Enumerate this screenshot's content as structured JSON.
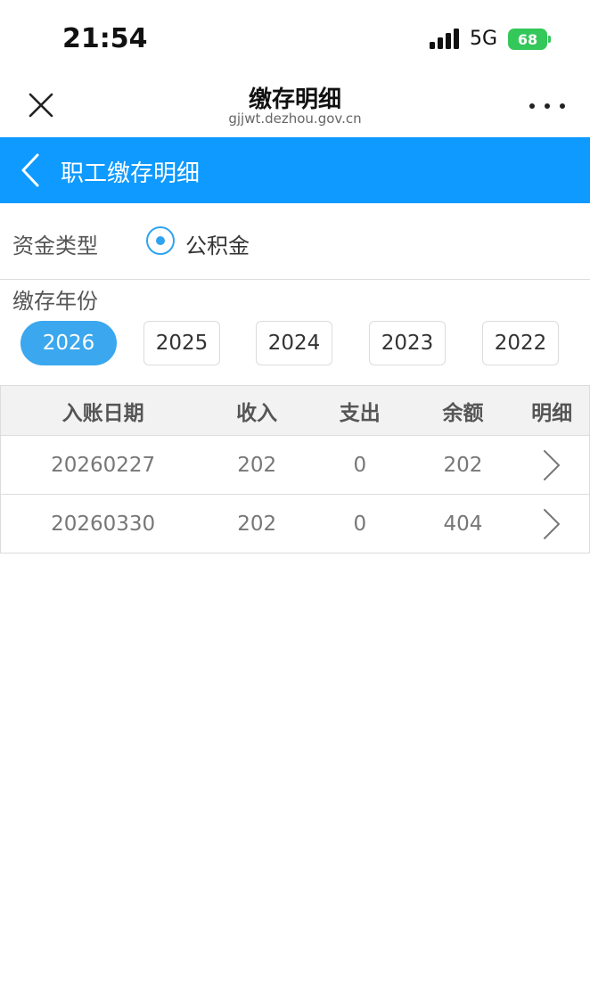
{
  "status_bar": {
    "time": "21:54",
    "network": "5G",
    "battery": "68"
  },
  "nav": {
    "title": "缴存明细",
    "url": "gjjwt.dezhou.gov.cn"
  },
  "app_bar": {
    "title": "职工缴存明细"
  },
  "fund_type": {
    "label": "资金类型",
    "option": "公积金"
  },
  "years": {
    "label": "缴存年份",
    "options": [
      "2026",
      "2025",
      "2024",
      "2023",
      "2022"
    ],
    "selected": "2026"
  },
  "table": {
    "headers": [
      "入账日期",
      "收入",
      "支出",
      "余额",
      "明细"
    ],
    "rows": [
      {
        "date": "20260227",
        "income": "202",
        "expense": "0",
        "balance": "202"
      },
      {
        "date": "20260330",
        "income": "202",
        "expense": "0",
        "balance": "404"
      }
    ]
  },
  "colors": {
    "accent": "#0f9aff",
    "selected": "#3aa7ee",
    "battery": "#34c759"
  }
}
